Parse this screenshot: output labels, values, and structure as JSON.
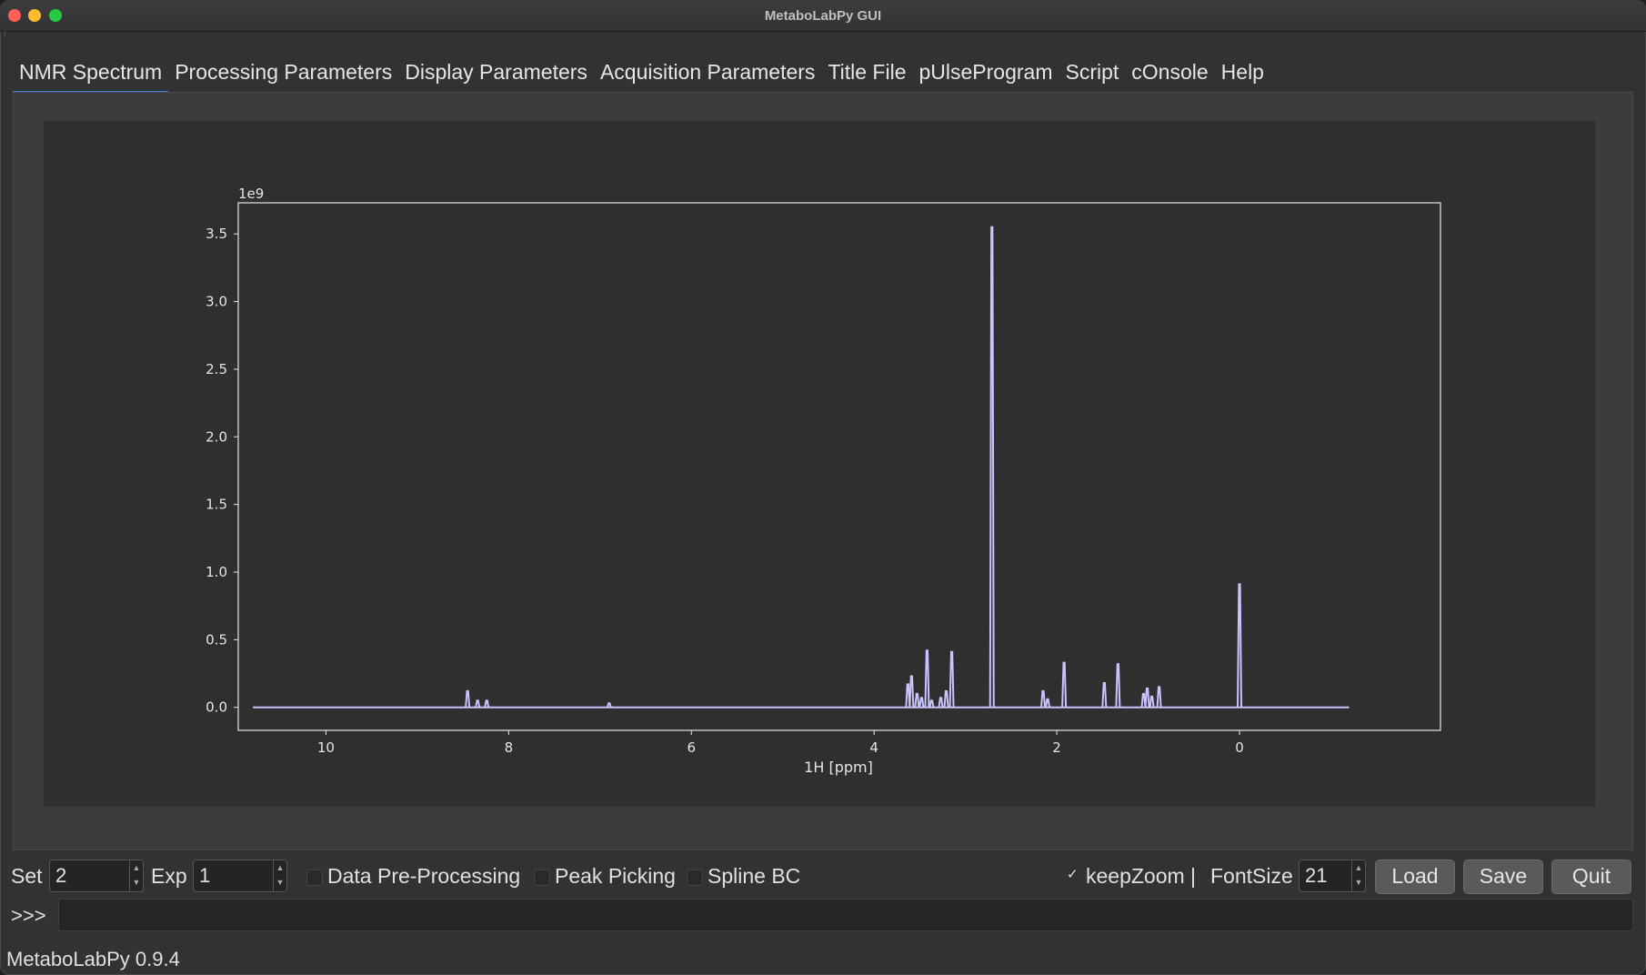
{
  "window": {
    "title": "MetaboLabPy GUI"
  },
  "tabs": [
    {
      "label": "NMR Spectrum"
    },
    {
      "label": "Processing Parameters"
    },
    {
      "label": "Display Parameters"
    },
    {
      "label": "Acquisition Parameters"
    },
    {
      "label": "Title File"
    },
    {
      "label": "pUlseProgram"
    },
    {
      "label": "Script"
    },
    {
      "label": "cOnsole"
    },
    {
      "label": "Help"
    }
  ],
  "chart_data": {
    "type": "line",
    "xlabel": "1H [ppm]",
    "ylabel": "",
    "y_offset_label": "1e9",
    "xlim": [
      10.96,
      -2.2
    ],
    "ylim": [
      -0.17,
      3.73
    ],
    "x_ticks": [
      10,
      8,
      6,
      4,
      2,
      0
    ],
    "y_ticks": [
      0.0,
      0.5,
      1.0,
      1.5,
      2.0,
      2.5,
      3.0,
      3.5
    ],
    "x_tick_labels": [
      "10",
      "8",
      "6",
      "4",
      "2",
      "0"
    ],
    "y_tick_labels": [
      "0.0",
      "0.5",
      "1.0",
      "1.5",
      "2.0",
      "2.5",
      "3.0",
      "3.5"
    ],
    "x_range": [
      10.8,
      -1.2
    ],
    "baseline": 0.0,
    "peaks": [
      {
        "x": 8.45,
        "y": 0.12
      },
      {
        "x": 8.34,
        "y": 0.05
      },
      {
        "x": 8.24,
        "y": 0.05
      },
      {
        "x": 6.9,
        "y": 0.03
      },
      {
        "x": 3.63,
        "y": 0.17
      },
      {
        "x": 3.59,
        "y": 0.23
      },
      {
        "x": 3.53,
        "y": 0.1
      },
      {
        "x": 3.48,
        "y": 0.07
      },
      {
        "x": 3.42,
        "y": 0.42
      },
      {
        "x": 3.37,
        "y": 0.05
      },
      {
        "x": 3.27,
        "y": 0.07
      },
      {
        "x": 3.21,
        "y": 0.12
      },
      {
        "x": 3.15,
        "y": 0.41
      },
      {
        "x": 2.71,
        "y": 3.55
      },
      {
        "x": 2.15,
        "y": 0.12
      },
      {
        "x": 2.1,
        "y": 0.06
      },
      {
        "x": 1.92,
        "y": 0.33
      },
      {
        "x": 1.48,
        "y": 0.18
      },
      {
        "x": 1.33,
        "y": 0.32
      },
      {
        "x": 1.05,
        "y": 0.1
      },
      {
        "x": 1.01,
        "y": 0.14
      },
      {
        "x": 0.96,
        "y": 0.08
      },
      {
        "x": 0.88,
        "y": 0.15
      },
      {
        "x": 0.0,
        "y": 0.91
      }
    ],
    "line_color": "#c8c4ff",
    "background": "#2f2f2f",
    "axes_color": "#e6e6e6"
  },
  "controls": {
    "set_label": "Set",
    "set_value": "2",
    "exp_label": "Exp",
    "exp_value": "1",
    "preprocessing_label": "Data Pre-Processing",
    "peakpicking_label": "Peak Picking",
    "splinebc_label": "Spline BC",
    "keepzoom_label": "keepZoom |",
    "keepzoom_check": "✓",
    "fontsize_label": "FontSize",
    "fontsize_value": "21",
    "load_label": "Load",
    "save_label": "Save",
    "quit_label": "Quit"
  },
  "console": {
    "prompt": ">>>"
  },
  "status": {
    "text": "MetaboLabPy 0.9.4"
  }
}
